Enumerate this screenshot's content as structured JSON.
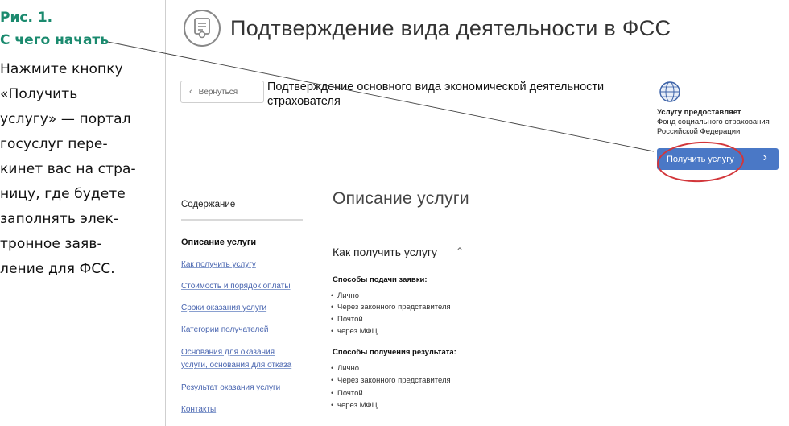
{
  "caption": {
    "figure": "Рис. 1.",
    "title": "С чего начать",
    "lines": [
      "Нажмите кнопку",
      "«Получить",
      "услугу» — портал",
      "госуслуг пере-",
      "кинет вас на стра-",
      "ницу, где будете",
      "заполнять элек-",
      "тронное заяв-",
      "ление для ФСС."
    ]
  },
  "page": {
    "title": "Подтверждение вида деятельности в ФСС",
    "service_icon": "certificate-icon",
    "back_label": "Вернуться",
    "subtitle": "Подтверждение основного вида экономической деятельности страхователя",
    "provider": {
      "logo": "fss-logo-icon",
      "label": "Услугу предоставляет",
      "line1": "Фонд социального страхования",
      "line2": "Российской Федерации"
    },
    "get_button_label": "Получить услугу",
    "accent_color": "#4a78c6",
    "highlight_color": "#d2363a"
  },
  "toc": {
    "heading": "Содержание",
    "current": "Описание услуги",
    "links": [
      "Как получить услугу",
      "Стоимость и порядок оплаты",
      "Сроки оказания услуги",
      "Категории получателей",
      "Основания для оказания услуги, основания для отказа",
      "Результат оказания услуги",
      "Контакты"
    ]
  },
  "content": {
    "section_title": "Описание услуги",
    "howto_title": "Как получить услугу",
    "apply_heading": "Способы подачи заявки:",
    "apply_methods": [
      "Лично",
      "Через законного представителя",
      "Почтой",
      "через МФЦ"
    ],
    "result_heading": "Способы получения результата:",
    "result_methods": [
      "Лично",
      "Через законного представителя",
      "Почтой",
      "через МФЦ"
    ]
  }
}
